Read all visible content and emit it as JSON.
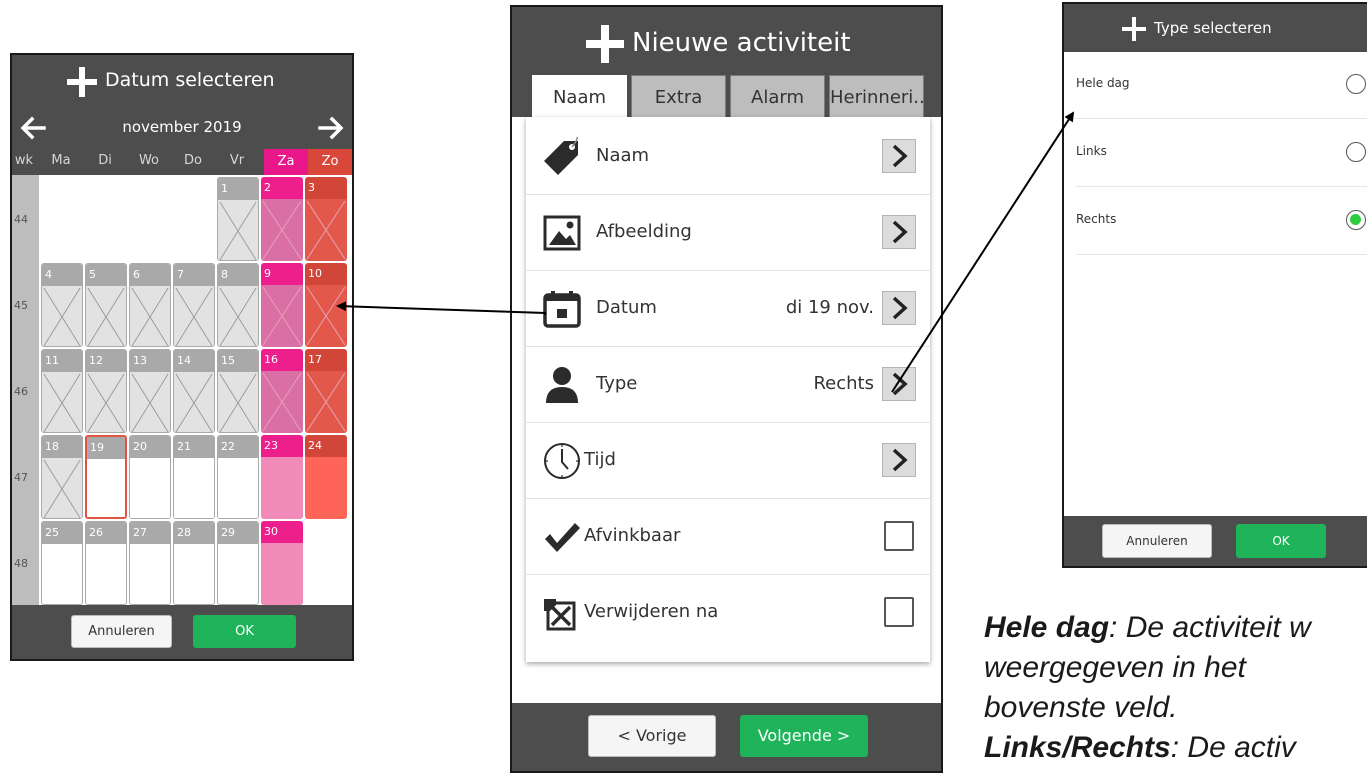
{
  "calendar": {
    "title": "Datum selecteren",
    "month": "november 2019",
    "headers": [
      "wk",
      "Ma",
      "Di",
      "Wo",
      "Do",
      "Vr",
      "Za",
      "Zo"
    ],
    "weeks": [
      "44",
      "45",
      "46",
      "47",
      "48"
    ],
    "days": [
      {
        "n": "1",
        "w": 0,
        "c": 4,
        "kind": "gray",
        "past": true
      },
      {
        "n": "2",
        "w": 0,
        "c": 5,
        "kind": "za",
        "past": true
      },
      {
        "n": "3",
        "w": 0,
        "c": 6,
        "kind": "zo",
        "past": true
      },
      {
        "n": "4",
        "w": 1,
        "c": 0,
        "kind": "gray",
        "past": true
      },
      {
        "n": "5",
        "w": 1,
        "c": 1,
        "kind": "gray",
        "past": true
      },
      {
        "n": "6",
        "w": 1,
        "c": 2,
        "kind": "gray",
        "past": true
      },
      {
        "n": "7",
        "w": 1,
        "c": 3,
        "kind": "gray",
        "past": true
      },
      {
        "n": "8",
        "w": 1,
        "c": 4,
        "kind": "gray",
        "past": true
      },
      {
        "n": "9",
        "w": 1,
        "c": 5,
        "kind": "za",
        "past": true
      },
      {
        "n": "10",
        "w": 1,
        "c": 6,
        "kind": "zo",
        "past": true
      },
      {
        "n": "11",
        "w": 2,
        "c": 0,
        "kind": "gray",
        "past": true
      },
      {
        "n": "12",
        "w": 2,
        "c": 1,
        "kind": "gray",
        "past": true
      },
      {
        "n": "13",
        "w": 2,
        "c": 2,
        "kind": "gray",
        "past": true
      },
      {
        "n": "14",
        "w": 2,
        "c": 3,
        "kind": "gray",
        "past": true
      },
      {
        "n": "15",
        "w": 2,
        "c": 4,
        "kind": "gray",
        "past": true
      },
      {
        "n": "16",
        "w": 2,
        "c": 5,
        "kind": "za",
        "past": true
      },
      {
        "n": "17",
        "w": 2,
        "c": 6,
        "kind": "zo",
        "past": true
      },
      {
        "n": "18",
        "w": 3,
        "c": 0,
        "kind": "gray",
        "past": true
      },
      {
        "n": "19",
        "w": 3,
        "c": 1,
        "kind": "gray",
        "past": false,
        "today": true
      },
      {
        "n": "20",
        "w": 3,
        "c": 2,
        "kind": "gray",
        "past": false
      },
      {
        "n": "21",
        "w": 3,
        "c": 3,
        "kind": "gray",
        "past": false
      },
      {
        "n": "22",
        "w": 3,
        "c": 4,
        "kind": "gray",
        "past": false
      },
      {
        "n": "23",
        "w": 3,
        "c": 5,
        "kind": "za",
        "past": false
      },
      {
        "n": "24",
        "w": 3,
        "c": 6,
        "kind": "zo",
        "past": false
      },
      {
        "n": "25",
        "w": 4,
        "c": 0,
        "kind": "gray",
        "past": false
      },
      {
        "n": "26",
        "w": 4,
        "c": 1,
        "kind": "gray",
        "past": false
      },
      {
        "n": "27",
        "w": 4,
        "c": 2,
        "kind": "gray",
        "past": false
      },
      {
        "n": "28",
        "w": 4,
        "c": 3,
        "kind": "gray",
        "past": false
      },
      {
        "n": "29",
        "w": 4,
        "c": 4,
        "kind": "gray",
        "past": false
      },
      {
        "n": "30",
        "w": 4,
        "c": 5,
        "kind": "za",
        "past": false
      }
    ],
    "cancel": "Annuleren",
    "ok": "OK"
  },
  "activity": {
    "title": "Nieuwe activiteit",
    "tabs": [
      "Naam",
      "Extra",
      "Alarm",
      "Herinneri..."
    ],
    "rows": {
      "naam": {
        "label": "Naam",
        "icon": "tag-icon"
      },
      "afbeelding": {
        "label": "Afbeelding",
        "icon": "image-icon"
      },
      "datum": {
        "label": "Datum",
        "value": "di 19 nov.",
        "icon": "calendar-icon"
      },
      "type": {
        "label": "Type",
        "value": "Rechts",
        "icon": "person-icon"
      },
      "tijd": {
        "label": "Tijd",
        "icon": "clock-icon"
      },
      "afvinkbaar": {
        "label": "Afvinkbaar",
        "icon": "checkmark-icon"
      },
      "verwijderen": {
        "label": "Verwijderen na",
        "icon": "delete-box-icon"
      }
    },
    "prev": "< Vorige",
    "next": "Volgende >"
  },
  "type_select": {
    "title": "Type selecteren",
    "options": [
      {
        "label": "Hele dag",
        "selected": false
      },
      {
        "label": "Links",
        "selected": false
      },
      {
        "label": "Rechts",
        "selected": true
      }
    ],
    "cancel": "Annuleren",
    "ok": "OK"
  },
  "caption": {
    "hele_dag": "Hele dag",
    "hele_dag_text": ": De activiteit w",
    "line2": "weergegeven in het",
    "line3": "bovenste veld.",
    "links_rechts": "Links/Rechts",
    "links_rechts_text": ": De activ"
  },
  "colors": {
    "header": "#4d4d4d",
    "saturday": "#e9178a",
    "sunday": "#d9473b",
    "ok_green": "#1fb35a",
    "radio_selected": "#2ecc40"
  }
}
